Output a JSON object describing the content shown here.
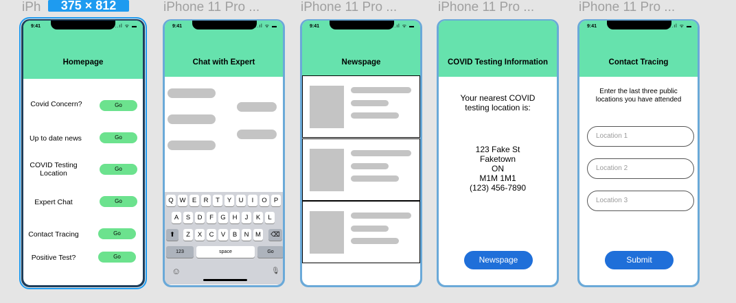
{
  "frames": [
    {
      "title": "iPhone 11 Pro ...",
      "badge": "375 × 812"
    },
    {
      "title": "iPhone 11 Pro ..."
    },
    {
      "title": "iPhone 11 Pro ..."
    },
    {
      "title": "iPhone 11 Pro ..."
    },
    {
      "title": "iPhone 11 Pro ..."
    }
  ],
  "frame1_title_visible": "iPh",
  "frame1_title_suffix": ".",
  "status": {
    "time": "9:41",
    "icons": "..ıl ᯤ ▬"
  },
  "homepage": {
    "title": "Homepage",
    "items": [
      {
        "label": "Covid Concern?",
        "button": "Go"
      },
      {
        "label": "Up to date news",
        "button": "Go"
      },
      {
        "label": "COVID Testing Location",
        "button": "Go"
      },
      {
        "label": "Expert Chat",
        "button": "Go"
      },
      {
        "label": "Contact Tracing",
        "button": "Go"
      },
      {
        "label": "Positive Test?",
        "button": "Go"
      }
    ]
  },
  "chat": {
    "title": "Chat with Expert",
    "keyboard": {
      "row1": [
        "Q",
        "W",
        "E",
        "R",
        "T",
        "Y",
        "U",
        "I",
        "O",
        "P"
      ],
      "row2": [
        "A",
        "S",
        "D",
        "F",
        "G",
        "H",
        "J",
        "K",
        "L"
      ],
      "row3": [
        "Z",
        "X",
        "C",
        "V",
        "B",
        "N",
        "M"
      ],
      "shift": "⬆",
      "backspace": "⌫",
      "numbers": "123",
      "space": "space",
      "go": "Go",
      "emoji": "☺",
      "mic": "🎙"
    }
  },
  "news": {
    "title": "Newspage"
  },
  "covid": {
    "title": "COVID Testing Information",
    "intro": "Your nearest COVID testing location is:",
    "address": [
      "123 Fake St",
      "Faketown",
      "ON",
      "M1M 1M1",
      "(123) 456-7890"
    ],
    "button": "Newspage"
  },
  "tracing": {
    "title": "Contact Tracing",
    "intro": "Enter the last three public locations you have attended",
    "placeholders": [
      "Location 1",
      "Location 2",
      "Location 3"
    ],
    "submit": "Submit"
  }
}
